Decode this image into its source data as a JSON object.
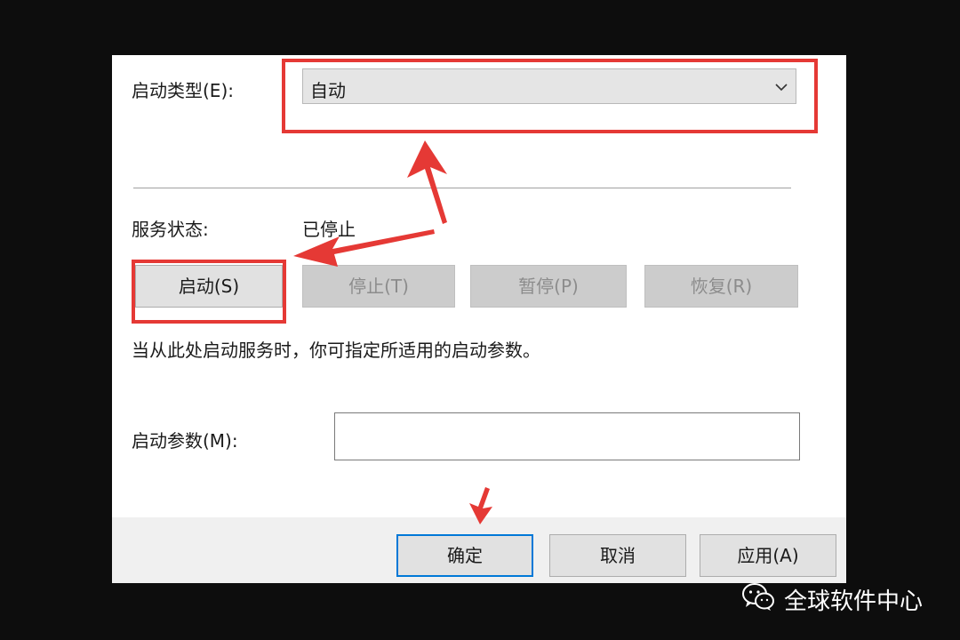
{
  "dialog": {
    "startup_type_label": "启动类型(E):",
    "startup_type_value": "自动",
    "service_status_label": "服务状态:",
    "service_status_value": "已停止",
    "buttons": {
      "start": "启动(S)",
      "stop": "停止(T)",
      "pause": "暂停(P)",
      "resume": "恢复(R)"
    },
    "hint": "当从此处启动服务时，你可指定所适用的启动参数。",
    "start_params_label": "启动参数(M):",
    "start_params_value": "",
    "footer": {
      "ok": "确定",
      "cancel": "取消",
      "apply": "应用(A)"
    }
  },
  "watermark": {
    "text": "全球软件中心",
    "icon": "wechat-icon"
  },
  "colors": {
    "annotation_red": "#e53935",
    "default_button_border": "#0078d7",
    "background": "#0d0d0d"
  }
}
